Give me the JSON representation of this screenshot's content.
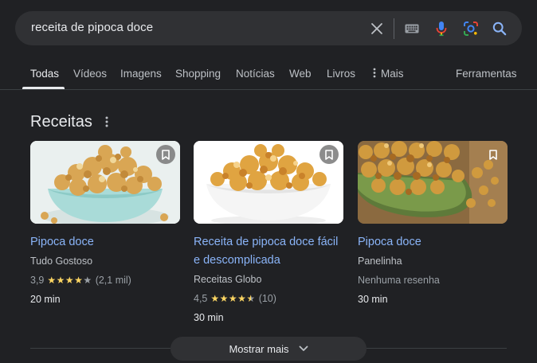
{
  "search": {
    "query": "receita de pipoca doce"
  },
  "tabs": [
    {
      "label": "Todas"
    },
    {
      "label": "Vídeos"
    },
    {
      "label": "Imagens"
    },
    {
      "label": "Shopping"
    },
    {
      "label": "Notícias"
    },
    {
      "label": "Web"
    },
    {
      "label": "Livros"
    },
    {
      "label": "Mais"
    },
    {
      "label": "Ferramentas"
    }
  ],
  "section": {
    "title": "Receitas"
  },
  "cards": [
    {
      "title": "Pipoca doce",
      "source": "Tudo Gostoso",
      "rating": "3,9",
      "stars": 3.9,
      "reviews": "(2,1 mil)",
      "time": "20 min"
    },
    {
      "title": "Receita de pipoca doce fácil e descomplicada",
      "source": "Receitas Globo",
      "rating": "4,5",
      "stars": 4.5,
      "reviews": "(10)",
      "time": "30 min"
    },
    {
      "title": "Pipoca doce",
      "source": "Panelinha",
      "no_reviews": "Nenhuma resenha",
      "time": "30 min"
    }
  ],
  "footer": {
    "show_more": "Mostrar mais"
  },
  "colors": {
    "background": "#202124",
    "link": "#8ab4f8",
    "star": "#fdd663"
  }
}
